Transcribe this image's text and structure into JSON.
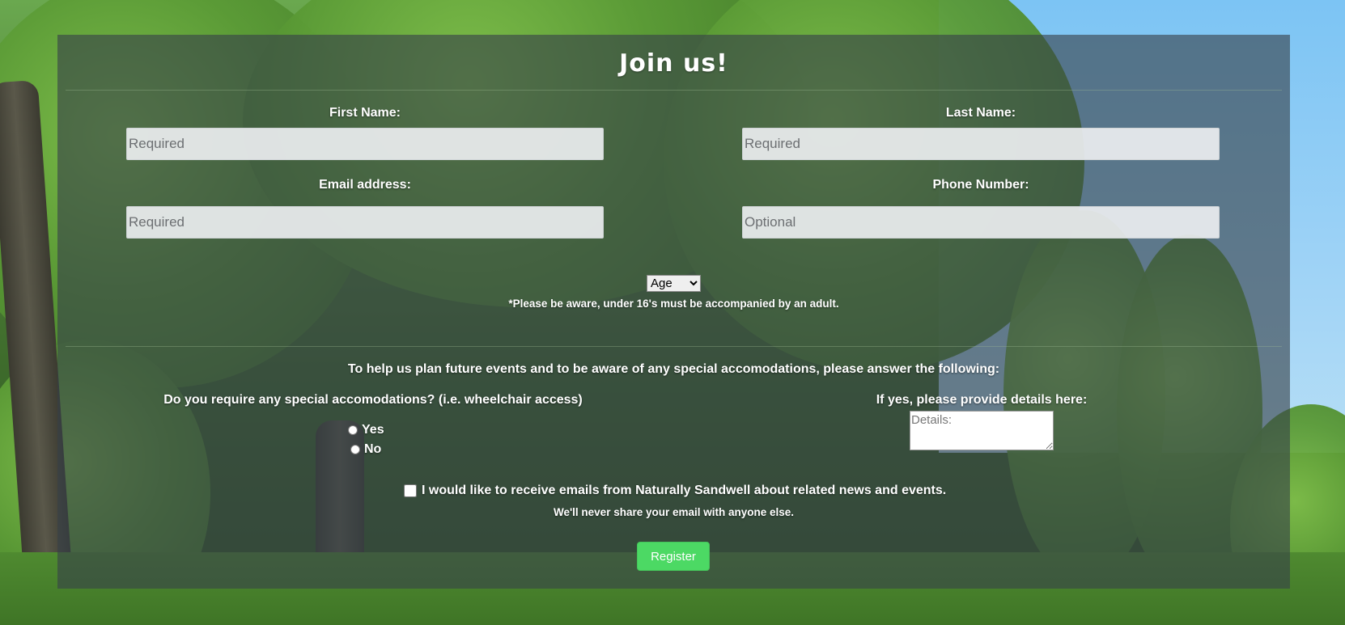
{
  "form": {
    "title": "Join us!",
    "first_name": {
      "label": "First Name:",
      "placeholder": "Required"
    },
    "last_name": {
      "label": "Last Name:",
      "placeholder": "Required"
    },
    "email": {
      "label": "Email address:",
      "placeholder": "Required"
    },
    "phone": {
      "label": "Phone Number:",
      "placeholder": "Optional"
    },
    "age": {
      "selected": "Age"
    },
    "age_note": "*Please be aware, under 16's must be accompanied by an adult.",
    "accommodations_intro": "To help us plan future events and to be aware of any special accomodations, please answer the following:",
    "accommodations_question": "Do you require any special accomodations? (i.e. wheelchair access)",
    "yes_label": "Yes",
    "no_label": "No",
    "details_label": "If yes, please provide details here:",
    "details_placeholder": "Details:",
    "newsletter_label": "I would like to receive emails from Naturally Sandwell about related news and events.",
    "privacy_note": "We'll never share your email with anyone else.",
    "register_label": "Register"
  },
  "colors": {
    "register_button": "#4cd964",
    "panel_overlay": "#374148"
  }
}
